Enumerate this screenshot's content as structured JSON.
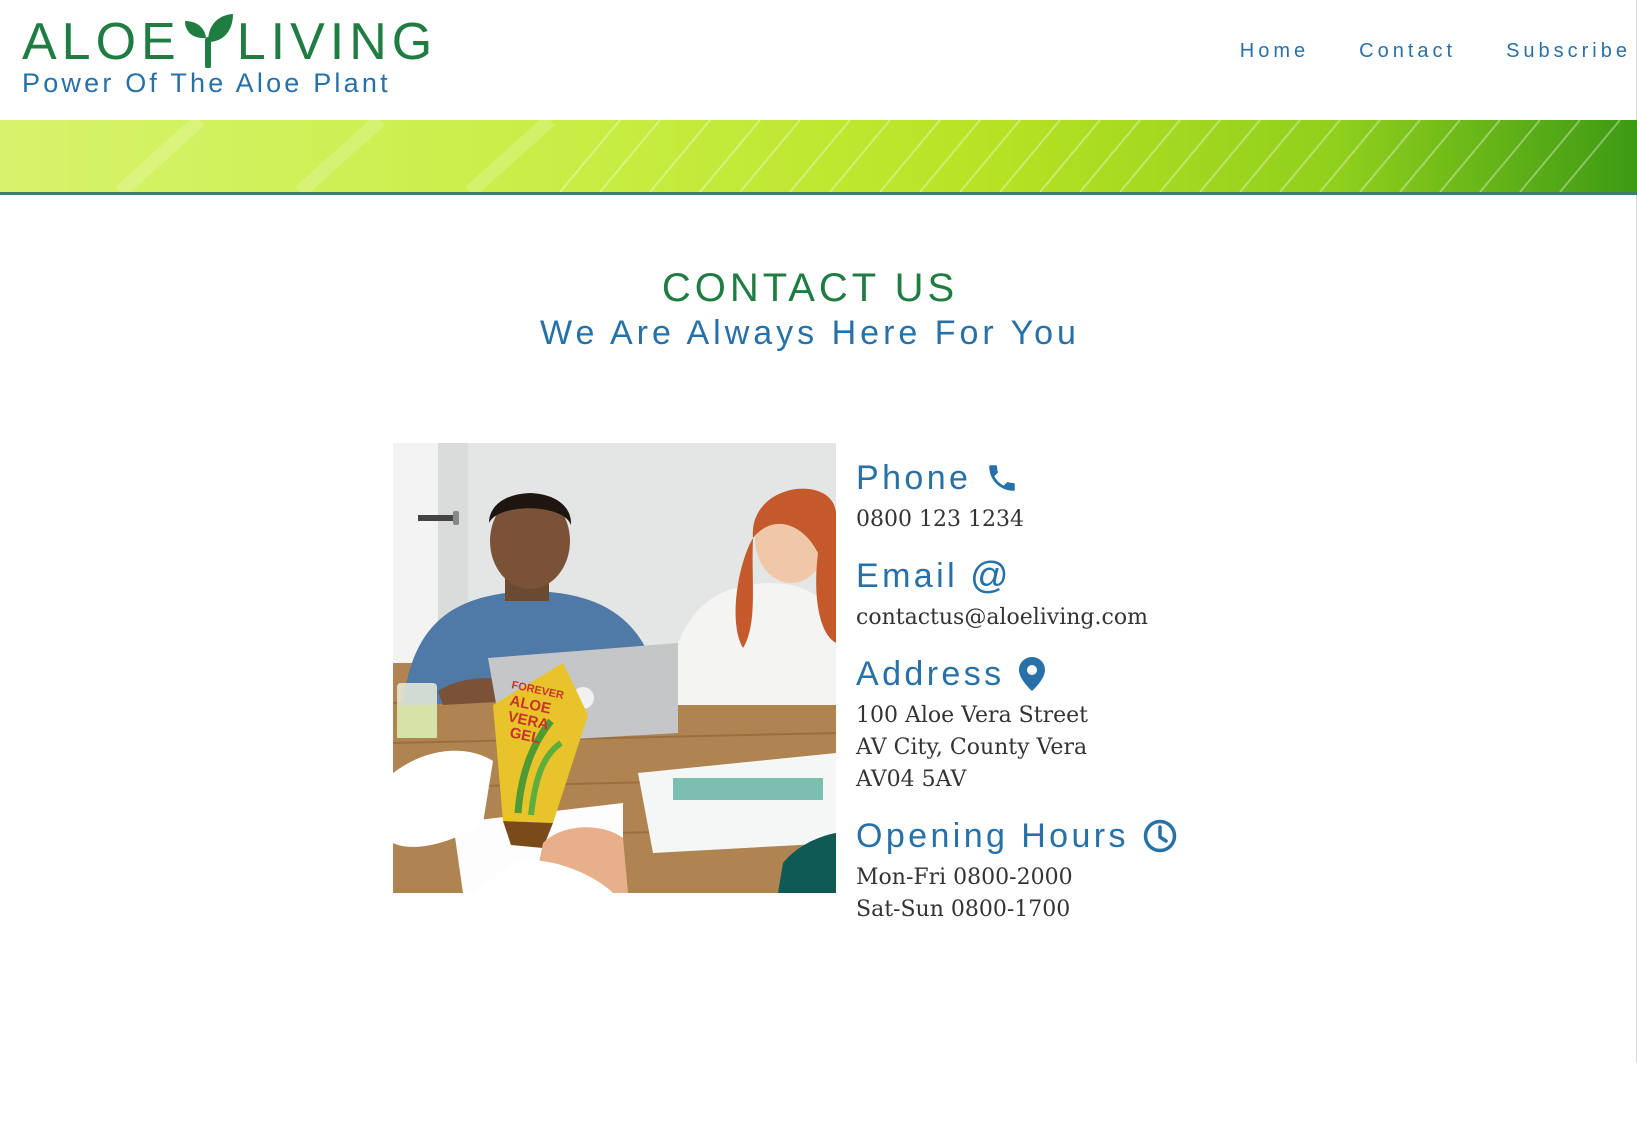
{
  "header": {
    "logo_word1": "ALOE",
    "logo_word2": "LIVING",
    "tagline": "Power Of The Aloe Plant",
    "nav": [
      {
        "label": "Home"
      },
      {
        "label": "Contact"
      },
      {
        "label": "Subscribe"
      }
    ]
  },
  "main": {
    "title": "CONTACT US",
    "subtitle": "We Are Always Here For You"
  },
  "contact": {
    "phone": {
      "heading": "Phone",
      "lines": [
        "0800 123 1234"
      ]
    },
    "email": {
      "heading": "Email",
      "lines": [
        "contactus@aloeliving.com"
      ]
    },
    "address": {
      "heading": "Address",
      "lines": [
        "100 Aloe Vera Street",
        "AV City, County Vera",
        "AV04 5AV"
      ]
    },
    "hours": {
      "heading": "Opening Hours",
      "lines": [
        "Mon-Fri 0800-2000",
        "Sat-Sun 0800-1700"
      ]
    }
  },
  "photo": {
    "product_label": [
      "FOREVER",
      "ALOE",
      "VERA",
      "GEL"
    ]
  },
  "colors": {
    "brand_green": "#1f7d42",
    "brand_blue": "#2771a8",
    "body_text": "#333333"
  },
  "icons": {
    "logo": "sprout-icon",
    "phone": "phone-icon",
    "email": "at-sign-icon",
    "address": "map-pin-icon",
    "hours": "clock-icon"
  }
}
